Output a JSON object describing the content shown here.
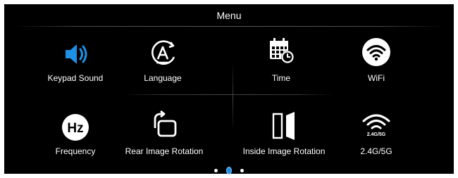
{
  "menu": {
    "title": "Menu"
  },
  "items": [
    {
      "label": "Keypad  Sound",
      "icon": "speaker-icon",
      "color": "#1e90e6"
    },
    {
      "label": "Language",
      "icon": "language-icon"
    },
    {
      "label": "Time",
      "icon": "calendar-clock-icon"
    },
    {
      "label": "WiFi",
      "icon": "wifi-icon"
    },
    {
      "label": "Frequency",
      "icon": "hz-icon"
    },
    {
      "label": "Rear  Image  Rotation",
      "icon": "rotate-icon"
    },
    {
      "label": "Inside  Image  Rotation",
      "icon": "mirror-flip-icon"
    },
    {
      "label": "2.4G/5G",
      "icon": "wifi-band-icon",
      "icon_text": "2.4G/5G"
    }
  ],
  "pager": {
    "pages": 3,
    "current": 2,
    "active_color": "#1e90e6"
  }
}
